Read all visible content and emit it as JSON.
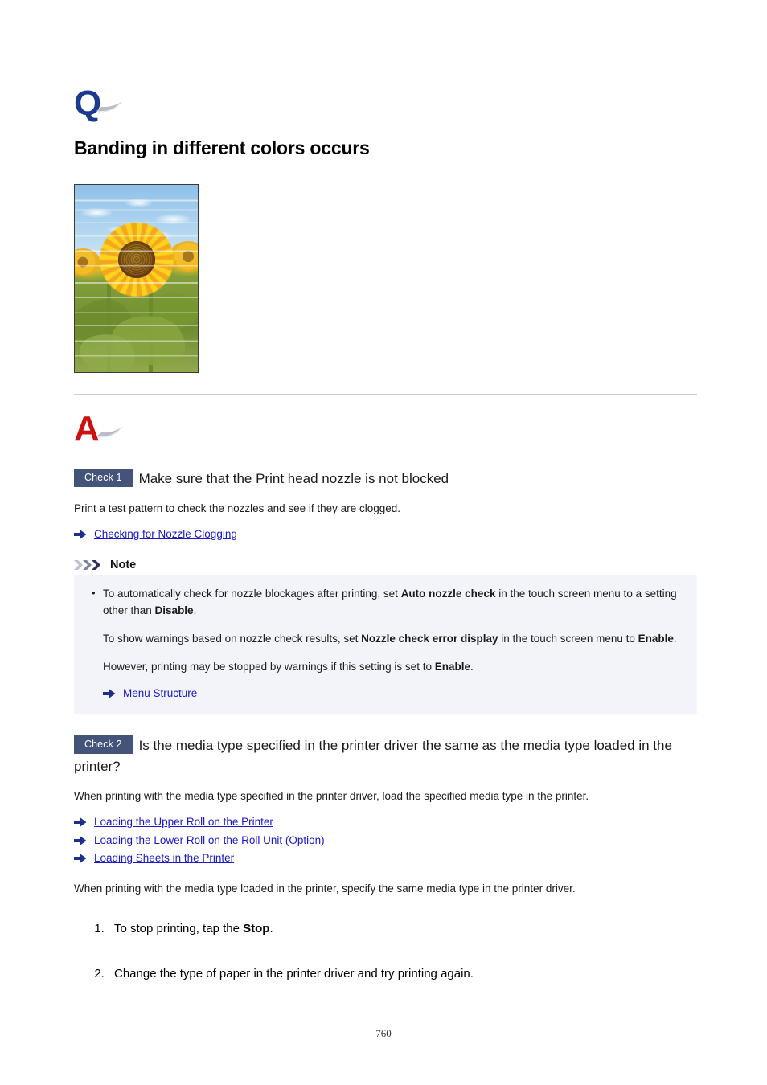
{
  "document": {
    "page_number": "760",
    "question_icon_letter": "Q",
    "answer_icon_letter": "A",
    "title": "Banding in different colors occurs"
  },
  "figure": {
    "name": "sunflower-banding-sample",
    "description": "Printed photo of sunflowers showing horizontal banding in different colors"
  },
  "checks": [
    {
      "badge": "Check 1",
      "heading": "Make sure that the Print head nozzle is not blocked",
      "body": "Print a test pattern to check the nozzles and see if they are clogged.",
      "links": [
        "Checking for Nozzle Clogging"
      ]
    },
    {
      "badge": "Check 2",
      "heading": "Is the media type specified in the printer driver the same as the media type loaded in the printer?",
      "body": "When printing with the media type specified in the printer driver, load the specified media type in the printer.",
      "links": [
        "Loading the Upper Roll on the Printer",
        "Loading the Lower Roll on the Roll Unit (Option)",
        "Loading Sheets in the Printer"
      ],
      "body2": "When printing with the media type loaded in the printer, specify the same media type in the printer driver."
    }
  ],
  "note": {
    "label": "Note",
    "bullet": {
      "text_1": "To automatically check for nozzle blockages after printing, set ",
      "bold_1": "Auto nozzle check",
      "text_2": " in the touch screen menu to a setting other than ",
      "bold_2": "Disable",
      "text_3": "."
    },
    "para_2": {
      "text_1": "To show warnings based on nozzle check results, set ",
      "bold_1": "Nozzle check error display",
      "text_2": " in the touch screen menu to ",
      "bold_2": "Enable",
      "text_3": "."
    },
    "para_3": {
      "text_1": "However, printing may be stopped by warnings if this setting is set to ",
      "bold_1": "Enable",
      "text_2": "."
    },
    "link": "Menu Structure"
  },
  "steps": [
    {
      "text_1": "To stop printing, tap the ",
      "bold_1": "Stop",
      "text_2": "."
    },
    {
      "text_1": "Change the type of paper in the printer driver and try printing again.",
      "bold_1": "",
      "text_2": ""
    }
  ],
  "colors": {
    "question_icon": "#1b3b8f",
    "answer_icon": "#cc1111",
    "check_badge_bg": "#44537a",
    "link": "#1a18c8",
    "note_box_bg": "#f2f4fa",
    "divider": "#cfcfcf"
  }
}
